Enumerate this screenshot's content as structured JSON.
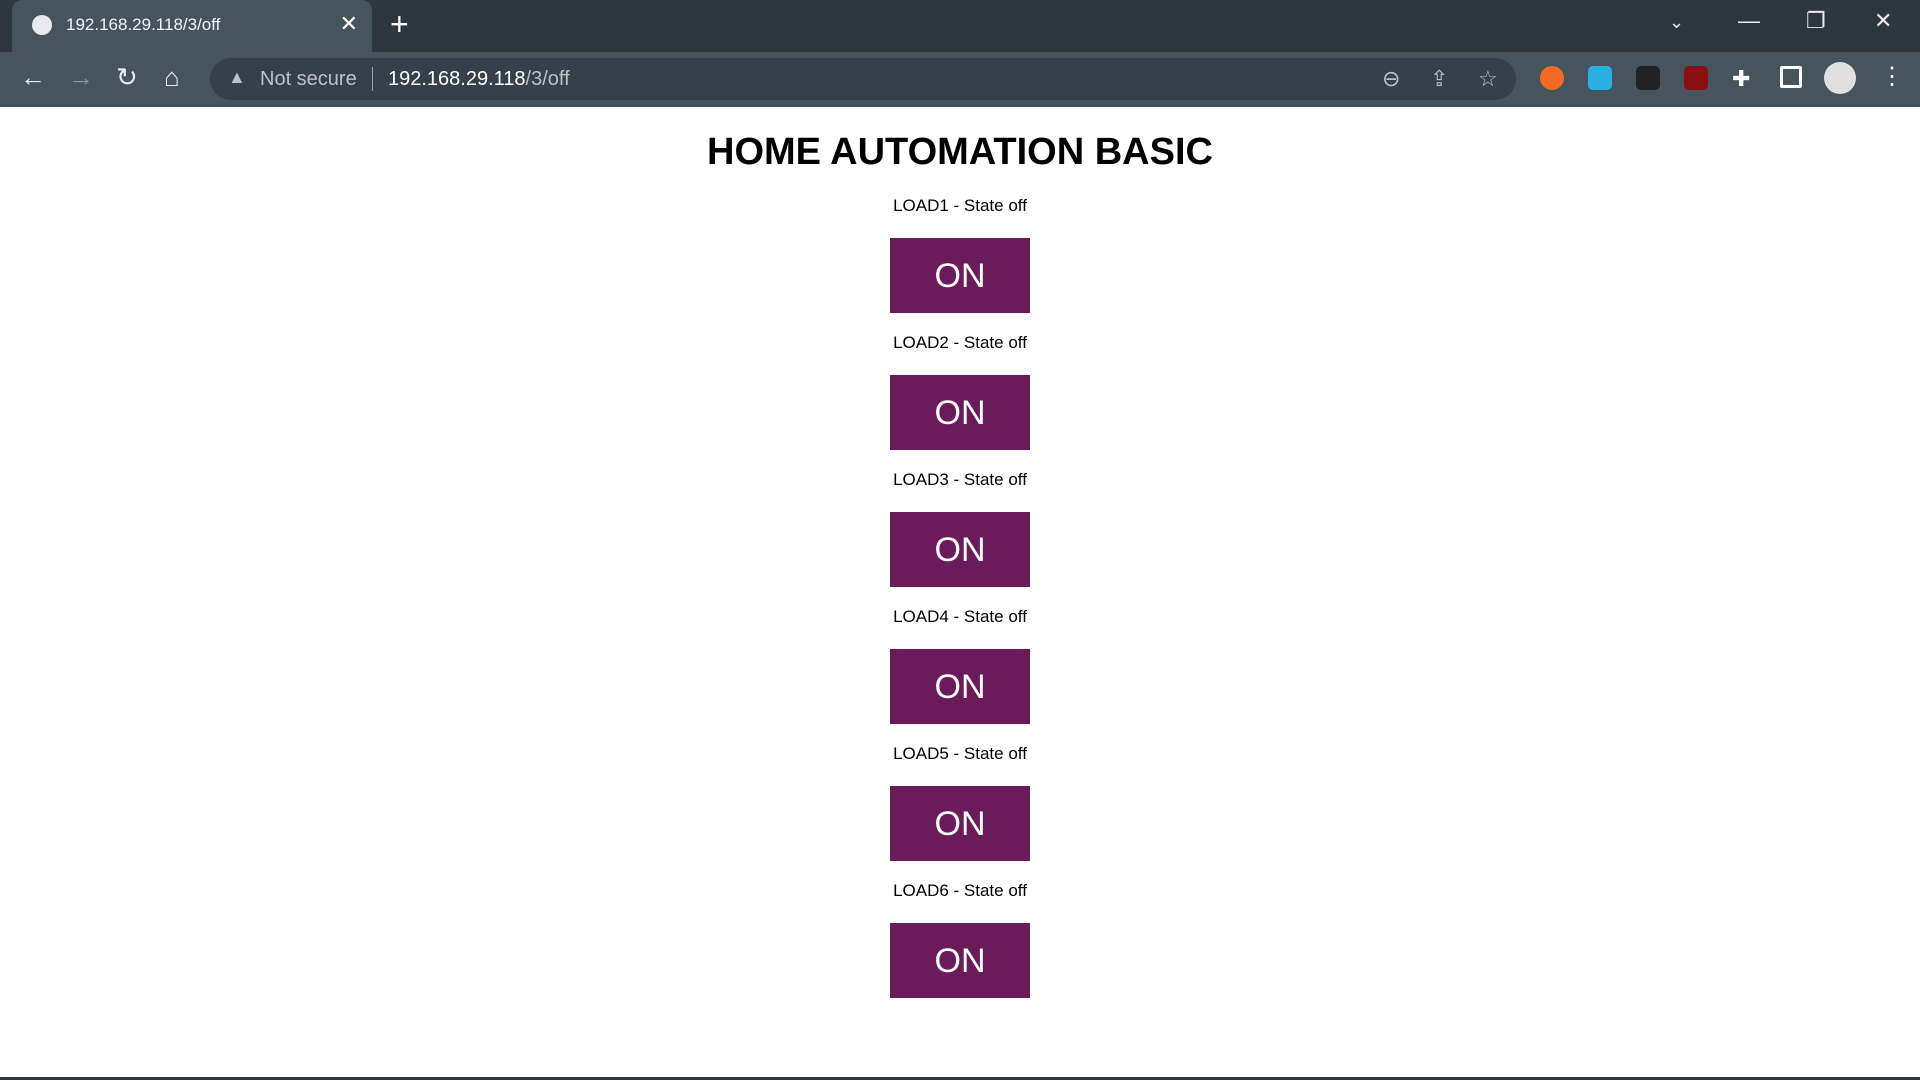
{
  "browser": {
    "tab_title": "192.168.29.118/3/off",
    "new_tab": "+",
    "not_secure": "Not secure",
    "url_host": "192.168.29.118",
    "url_path": "/3/off"
  },
  "page": {
    "title": "HOME AUTOMATION BASIC",
    "button_color": "#6b1a5a",
    "loads": [
      {
        "label": "LOAD1 - State off",
        "button": "ON"
      },
      {
        "label": "LOAD2 - State off",
        "button": "ON"
      },
      {
        "label": "LOAD3 - State off",
        "button": "ON"
      },
      {
        "label": "LOAD4 - State off",
        "button": "ON"
      },
      {
        "label": "LOAD5 - State off",
        "button": "ON"
      },
      {
        "label": "LOAD6 - State off",
        "button": "ON"
      }
    ]
  }
}
